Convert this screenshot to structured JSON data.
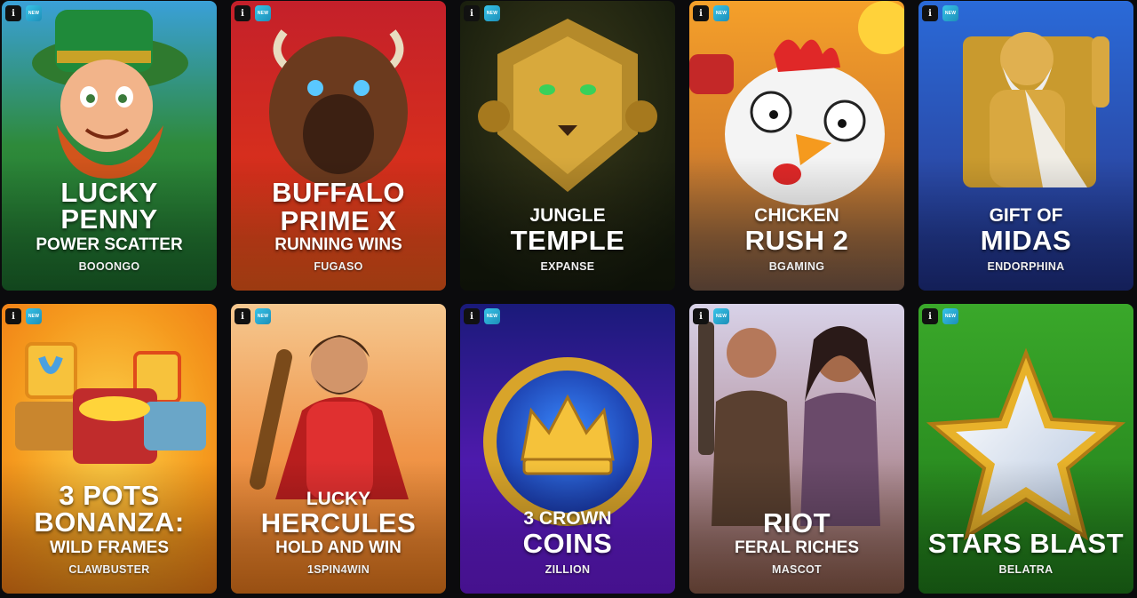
{
  "badges": {
    "info": "i",
    "new": "NEW"
  },
  "games": [
    {
      "lines": [
        "LUCKY",
        "PENNY",
        "POWER SCATTER"
      ],
      "provider": "BOOONGO",
      "new": true
    },
    {
      "lines": [
        "BUFFALO",
        "PRIME X",
        "RUNNING WINS"
      ],
      "provider": "FUGASO",
      "new": true
    },
    {
      "lines": [
        "JUNGLE",
        "TEMPLE"
      ],
      "provider": "EXPANSE",
      "new": true
    },
    {
      "lines": [
        "CHICKEN",
        "RUSH 2"
      ],
      "provider": "BGAMING",
      "new": true
    },
    {
      "lines": [
        "GIFT OF",
        "MIDAS"
      ],
      "provider": "ENDORPHINA",
      "new": true
    },
    {
      "lines": [
        "3 POTS",
        "BONANZA:",
        "WILD FRAMES"
      ],
      "provider": "CLAWBUSTER",
      "new": true
    },
    {
      "lines": [
        "LUCKY",
        "HERCULES",
        "HOLD AND WIN"
      ],
      "provider": "1SPIN4WIN",
      "new": true
    },
    {
      "lines": [
        "3 CROWN",
        "COINS"
      ],
      "provider": "ZILLION",
      "new": true
    },
    {
      "lines": [
        "RIOT",
        "FERAL RICHES"
      ],
      "provider": "MASCOT",
      "new": true
    },
    {
      "lines": [
        "STARS BLAST"
      ],
      "provider": "BELATRA",
      "new": true
    }
  ]
}
